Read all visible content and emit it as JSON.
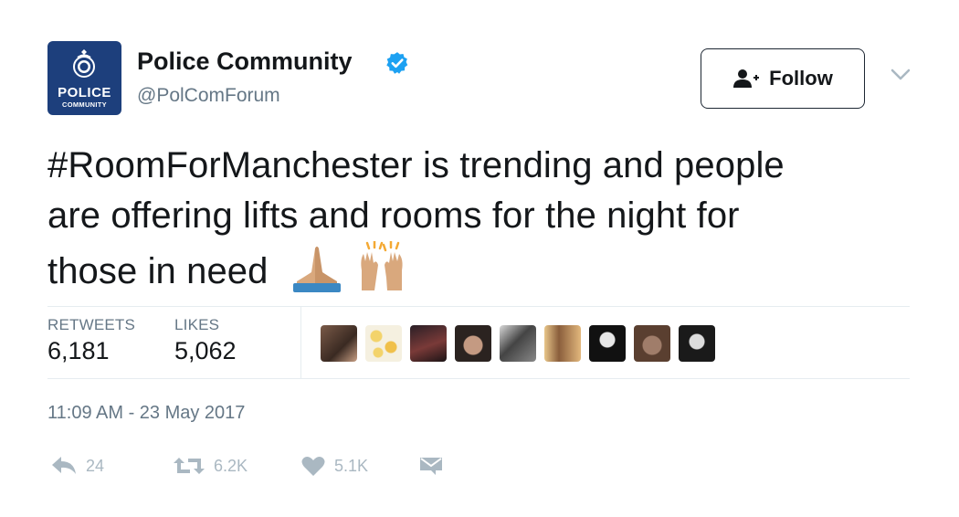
{
  "account": {
    "display_name": "Police Community",
    "handle": "@PolComForum",
    "avatar_logo_line1": "POLICE",
    "avatar_logo_line2": "COMMUNITY",
    "verified": true
  },
  "follow_button": {
    "label": "Follow"
  },
  "tweet": {
    "text_line1": "#RoomForManchester is trending and people",
    "text_line2": "are offering lifts and rooms for the night for",
    "text_line3": "those in need",
    "emojis": [
      "folded-hands-emoji",
      "raising-hands-emoji"
    ]
  },
  "stats": {
    "retweets_label": "RETWEETS",
    "retweets_value": "6,181",
    "likes_label": "LIKES",
    "likes_value": "5,062"
  },
  "likers_count_shown": 9,
  "timestamp": "11:09 AM - 23 May 2017",
  "actions": {
    "reply_count": "24",
    "retweet_count": "6.2K",
    "like_count": "5.1K"
  },
  "colors": {
    "text": "#14171a",
    "secondary": "#657786",
    "action_icon": "#aab8c2",
    "verified_badge": "#1da1f2",
    "avatar_bg": "#1d3f7c"
  }
}
